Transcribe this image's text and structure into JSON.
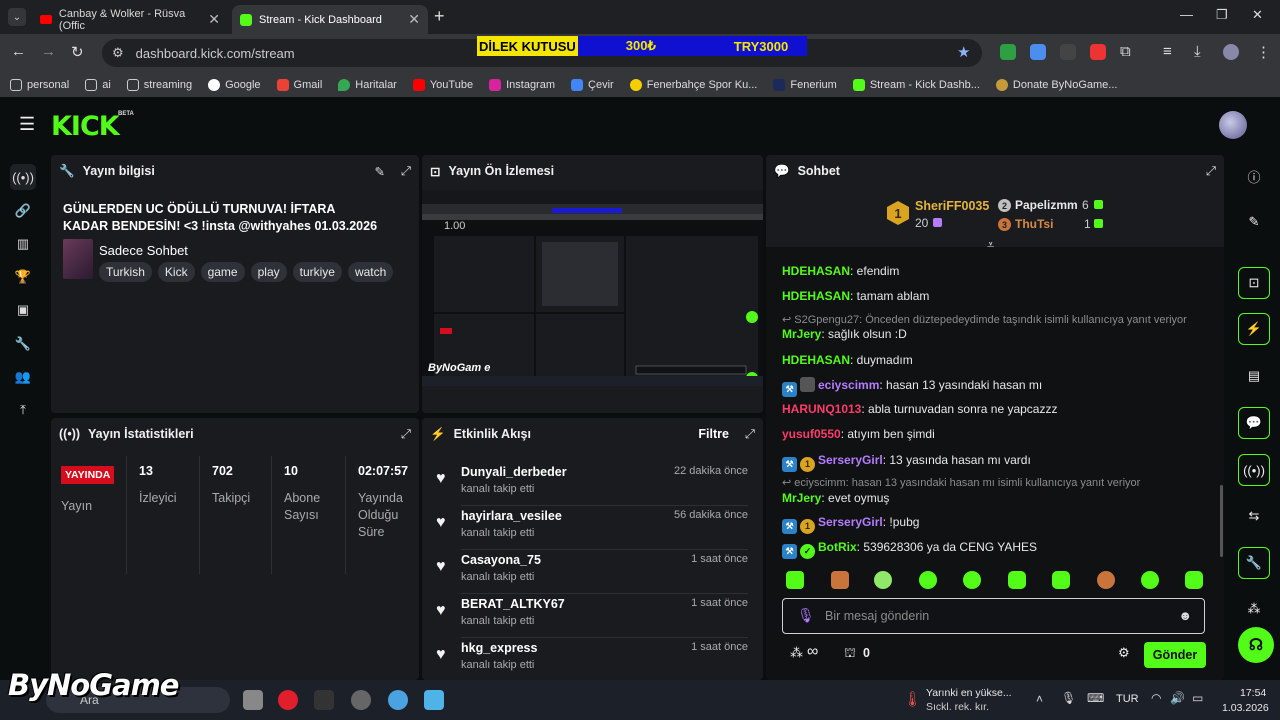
{
  "browser": {
    "tabs": [
      {
        "title": "Canbay & Wolker - Rüsva (Offic",
        "close": "✕"
      },
      {
        "title": "Stream - Kick Dashboard",
        "close": "✕"
      }
    ],
    "new_tab": "+",
    "url": "dashboard.kick.com/stream",
    "donate_banner": {
      "label": "DİLEK KUTUSU",
      "amount": "300₺",
      "currency_goal": "TRY3000"
    },
    "bookmarks": [
      "personal",
      "ai",
      "streaming",
      "Google",
      "Gmail",
      "Haritalar",
      "YouTube",
      "Instagram",
      "Çevir",
      "Fenerbahçe Spor Ku...",
      "Fenerium",
      "Stream - Kick Dashb...",
      "Donate ByNoGame..."
    ]
  },
  "kick": {
    "logo": "KICK",
    "beta": "BETA"
  },
  "stream_info": {
    "header": "Yayın bilgisi",
    "title": "GÜNLERDEN UC ÖDÜLLÜ TURNUVA! İFTARA KADAR BENDESİN! <3 !insta @withyahes 01.03.2026",
    "category": "Sadece Sohbet",
    "tags": [
      "Turkish",
      "Kick",
      "game",
      "play",
      "turkiye",
      "watch"
    ]
  },
  "preview": {
    "header": "Yayın Ön İzlemesi",
    "volume": "1.00",
    "overlay_text": "ByNoGam e"
  },
  "stats": {
    "header": "Yayın İstatistikleri",
    "live_badge": "YAYINDA",
    "status_label": "Yayın",
    "items": [
      {
        "value": "13",
        "label": "İzleyici"
      },
      {
        "value": "702",
        "label": "Takipçi"
      },
      {
        "value": "10",
        "label": "Abone Sayısı"
      },
      {
        "value": "02:07:57",
        "label": "Yayında Olduğu Süre"
      }
    ]
  },
  "activity": {
    "header": "Etkinlik Akışı",
    "filter": "Filtre",
    "events": [
      {
        "name": "Dunyali_derbeder",
        "sub": "kanalı takip etti",
        "time": "22 dakika önce"
      },
      {
        "name": "hayirlara_vesilee",
        "sub": "kanalı takip etti",
        "time": "56 dakika önce"
      },
      {
        "name": "Casayona_75",
        "sub": "kanalı takip etti",
        "time": "1 saat önce"
      },
      {
        "name": "BERAT_ALTKY67",
        "sub": "kanalı takip etti",
        "time": "1 saat önce"
      },
      {
        "name": "hkg_express",
        "sub": "kanalı takip etti",
        "time": "1 saat önce"
      }
    ]
  },
  "chat": {
    "header": "Sohbet",
    "leaderboard": [
      {
        "rank": "1",
        "name": "SheriFF0035",
        "count": "20"
      },
      {
        "rank": "2",
        "name": "Papelizmm",
        "count": "6"
      },
      {
        "rank": "3",
        "name": "ThuTsi",
        "count": "1"
      }
    ],
    "messages": [
      {
        "user": "HDEHASAN",
        "text": ": efendim",
        "color": "#53fc18"
      },
      {
        "user": "HDEHASAN",
        "text": ": tamam ablam",
        "color": "#53fc18"
      },
      {
        "reply": "S2Gpengu27: Önceden düztepedeydimde taşındık isimli kullanıcıya yanıt veriyor"
      },
      {
        "user": "MrJery",
        "text": ": sağlık olsun :D",
        "color": "#53fc18"
      },
      {
        "user": "HDEHASAN",
        "text": ": duymadım",
        "color": "#53fc18"
      },
      {
        "user": "eciyscimm",
        "text": ": hasan 13 yasındaki hasan mı",
        "color": "#b57cff"
      },
      {
        "user": "HARUNQ1013",
        "text": ": abla turnuvadan sonra ne yapcazzz",
        "color": "#ff3b6b"
      },
      {
        "user": "yusuf0550",
        "text": ": atıyım ben şimdi",
        "color": "#ff3b6b"
      },
      {
        "user": "SerseryGirl",
        "text": ": 13 yasında hasan mı vardı",
        "color": "#b57cff"
      },
      {
        "reply": "eciyscimm: hasan 13 yasındaki hasan mı isimli kullanıcıya yanıt veriyor"
      },
      {
        "user": "MrJery",
        "text": ": evet oymuş",
        "color": "#53fc18"
      },
      {
        "user": "SerseryGirl",
        "text": ": !pubg",
        "color": "#b57cff"
      },
      {
        "user": "BotRix",
        "text": ": 539628306 ya da CENG YAHES",
        "color": "#53fc18"
      }
    ],
    "input_placeholder": "Bir mesaj gönderin",
    "infinity": "∞",
    "gift_count": "0",
    "send": "Gönder"
  },
  "taskbar": {
    "search": "Ara",
    "weather_line1": "Yarınki en yükse...",
    "weather_line2": "Sıckl. rek. kır.",
    "lang": "TUR",
    "time": "17:54",
    "date": "1.03.2026"
  },
  "watermark": "ByNoGame"
}
